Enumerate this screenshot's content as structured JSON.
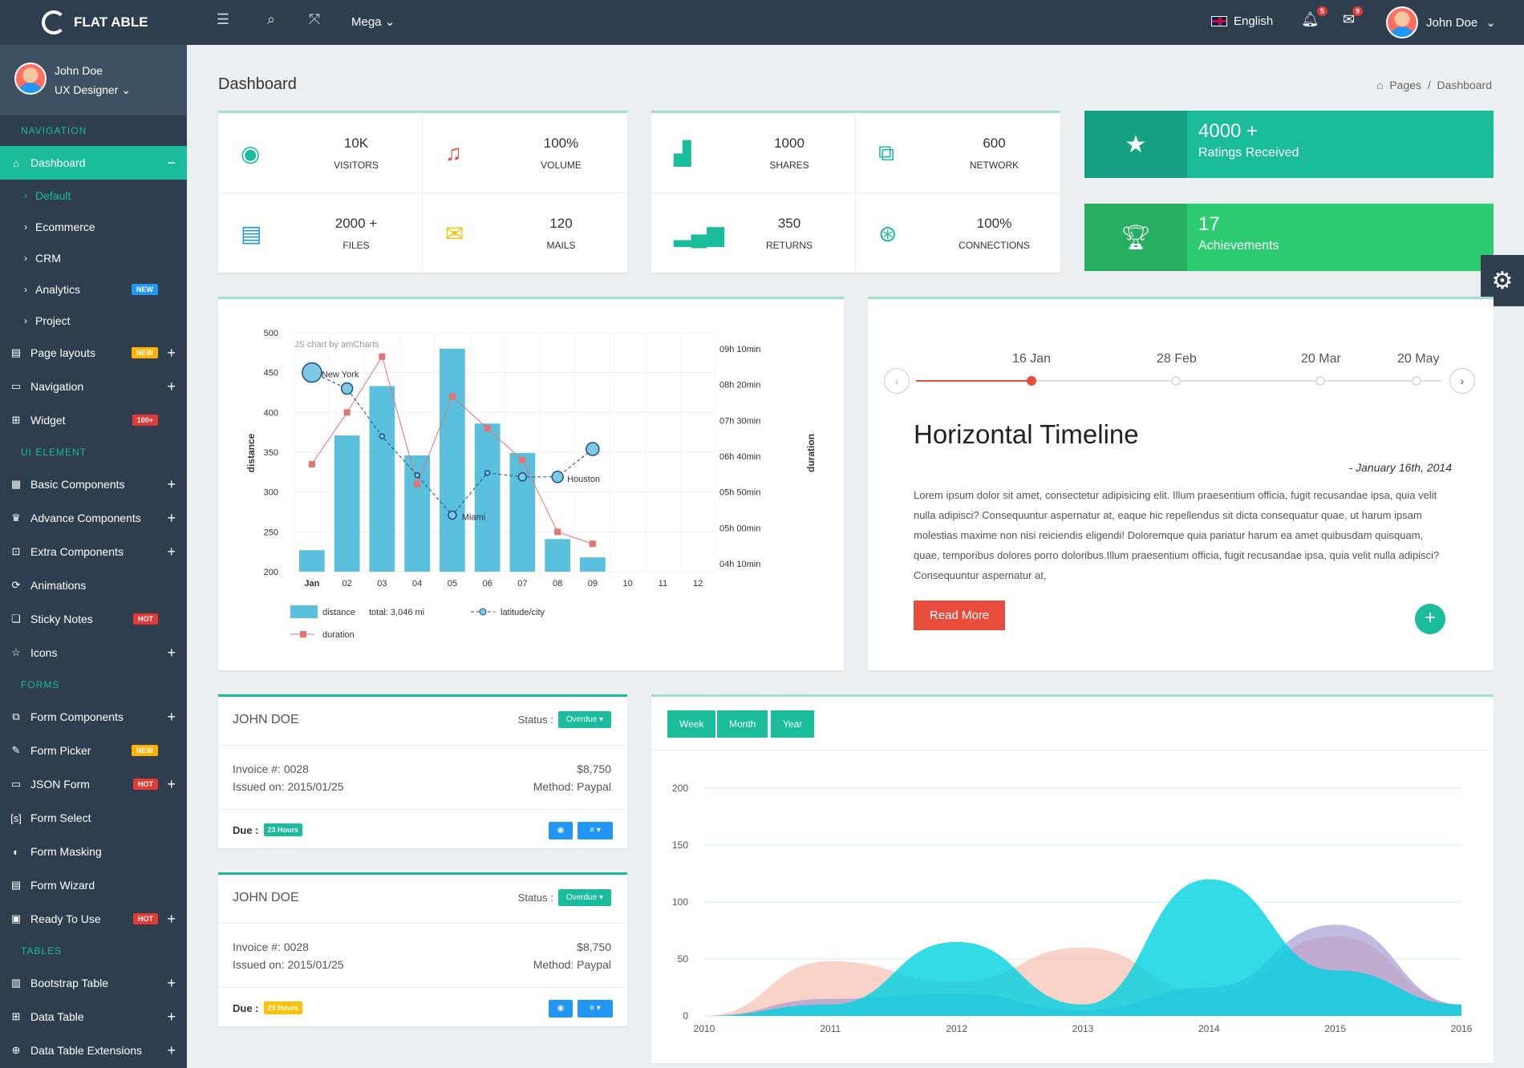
{
  "topbar": {
    "brand": "FLAT ABLE",
    "mega": "Mega",
    "language": "English",
    "notif_count": "5",
    "msg_count": "9",
    "user": "John Doe"
  },
  "sidebar": {
    "user": "John Doe",
    "role": "UX Designer",
    "sections": {
      "nav": "NAVIGATION",
      "ui": "UI ELEMENT",
      "forms": "FORMS",
      "tables": "TABLES"
    },
    "dashboard": "Dashboard",
    "subs": [
      "Default",
      "Ecommerce",
      "CRM",
      "Analytics",
      "Project"
    ],
    "analytics_tag": "NEW",
    "nav_items": [
      {
        "label": "Page layouts",
        "tag": "NEW"
      },
      {
        "label": "Navigation"
      },
      {
        "label": "Widget",
        "tag": "100+"
      }
    ],
    "ui_items": [
      {
        "label": "Basic Components"
      },
      {
        "label": "Advance Components"
      },
      {
        "label": "Extra Components"
      },
      {
        "label": "Animations"
      },
      {
        "label": "Sticky Notes",
        "tag": "HOT"
      },
      {
        "label": "Icons"
      }
    ],
    "form_items": [
      {
        "label": "Form Components"
      },
      {
        "label": "Form Picker",
        "tag": "NEW"
      },
      {
        "label": "JSON Form",
        "tag": "HOT"
      },
      {
        "label": "Form Select"
      },
      {
        "label": "Form Masking"
      },
      {
        "label": "Form Wizard"
      },
      {
        "label": "Ready To Use",
        "tag": "HOT"
      }
    ],
    "table_items": [
      {
        "label": "Bootstrap Table"
      },
      {
        "label": "Data Table"
      },
      {
        "label": "Data Table Extensions"
      }
    ]
  },
  "page": {
    "title": "Dashboard",
    "crumb1": "Pages",
    "crumb2": "Dashboard"
  },
  "stats1": [
    {
      "v": "10K",
      "l": "VISITORS"
    },
    {
      "v": "100%",
      "l": "VOLUME"
    },
    {
      "v": "2000 +",
      "l": "FILES"
    },
    {
      "v": "120",
      "l": "MAILS"
    }
  ],
  "stats2": [
    {
      "v": "1000",
      "l": "SHARES"
    },
    {
      "v": "600",
      "l": "NETWORK"
    },
    {
      "v": "350",
      "l": "RETURNS"
    },
    {
      "v": "100%",
      "l": "CONNECTIONS"
    }
  ],
  "ratings": {
    "v": "4000 +",
    "l": "Ratings Received"
  },
  "achieve": {
    "v": "17",
    "l": "Achievements"
  },
  "colors": {
    "teal": "#1abc9c",
    "green": "#2ecc71",
    "red": "#e74c3c",
    "blue": "#5bc0de"
  },
  "chart_data": [
    {
      "type": "bar",
      "credit": "JS chart by amCharts",
      "categories": [
        "Jan",
        "02",
        "03",
        "04",
        "05",
        "06",
        "07",
        "08",
        "09",
        "10",
        "11",
        "12"
      ],
      "ylabel": "distance",
      "y2label": "duration",
      "ylim": [
        200,
        500
      ],
      "yticks": [
        200,
        250,
        300,
        350,
        400,
        450,
        500
      ],
      "y2ticks": [
        "04h 10min",
        "05h 00min",
        "05h 50min",
        "06h 40min",
        "07h 30min",
        "08h 20min",
        "09h 10min"
      ],
      "series": [
        {
          "name": "distance",
          "values": [
            227,
            371,
            433,
            346,
            480,
            386,
            349,
            241,
            218,
            null,
            null,
            null
          ]
        },
        {
          "name": "latitude/city",
          "values": [
            450,
            430,
            370,
            321,
            271,
            324,
            319,
            319,
            354,
            null,
            null,
            null
          ]
        },
        {
          "name": "duration",
          "values": [
            335,
            400,
            470,
            310,
            420,
            380,
            340,
            250,
            235,
            null,
            null,
            null
          ]
        }
      ],
      "point_labels": [
        {
          "i": 0,
          "text": "New York"
        },
        {
          "i": 4,
          "text": "Miami"
        },
        {
          "i": 7,
          "text": "Houston"
        }
      ],
      "legend": [
        "distance",
        "total: 3,046 mi",
        "latitude/city",
        "duration"
      ]
    },
    {
      "type": "area",
      "x": [
        "2010",
        "2011",
        "2012",
        "2013",
        "2014",
        "2015",
        "2016"
      ],
      "ylim": [
        0,
        200
      ],
      "yticks": [
        0,
        50,
        100,
        150,
        200
      ],
      "series": [
        {
          "values": [
            0,
            48,
            30,
            60,
            20,
            70,
            10
          ]
        },
        {
          "values": [
            0,
            15,
            20,
            5,
            25,
            80,
            10
          ]
        },
        {
          "values": [
            0,
            10,
            65,
            10,
            120,
            40,
            10
          ]
        }
      ]
    }
  ],
  "timeline": {
    "dates": [
      "16 Jan",
      "28 Feb",
      "20 Mar",
      "20 May"
    ],
    "title": "Horizontal Timeline",
    "date": "- January 16th, 2014",
    "text": "Lorem ipsum dolor sit amet, consectetur adipisicing elit. Illum praesentium officia, fugit recusandae ipsa, quia velit nulla adipisci? Consequuntur aspernatur at, eaque hic repellendus sit dicta consequatur quae, ut harum ipsam molestias maxime non nisi reiciendis eligendi! Doloremque quia pariatur harum ea amet quibusdam quisquam, quae, temporibus dolores porro doloribus.Illum praesentium officia, fugit recusandae ipsa, quia velit nulla adipisci? Consequuntur aspernatur at,",
    "button": "Read More"
  },
  "invoices": [
    {
      "name": "JOHN DOE",
      "status_label": "Status :",
      "status": "Overdue",
      "invoice": "Invoice #:  0028",
      "amount": "$8,750",
      "issued": "Issued on: 2015/01/25",
      "method": "Method: Paypal",
      "due_label": "Due :",
      "due": "23 Hours"
    },
    {
      "name": "JOHN DOE",
      "status_label": "Status :",
      "status": "Overdue",
      "invoice": "Invoice #:  0028",
      "amount": "$8,750",
      "issued": "Issued on: 2015/01/25",
      "method": "Method: Paypal",
      "due_label": "Due :",
      "due": "23 Hours"
    }
  ],
  "area_tabs": [
    "Week",
    "Month",
    "Year"
  ]
}
